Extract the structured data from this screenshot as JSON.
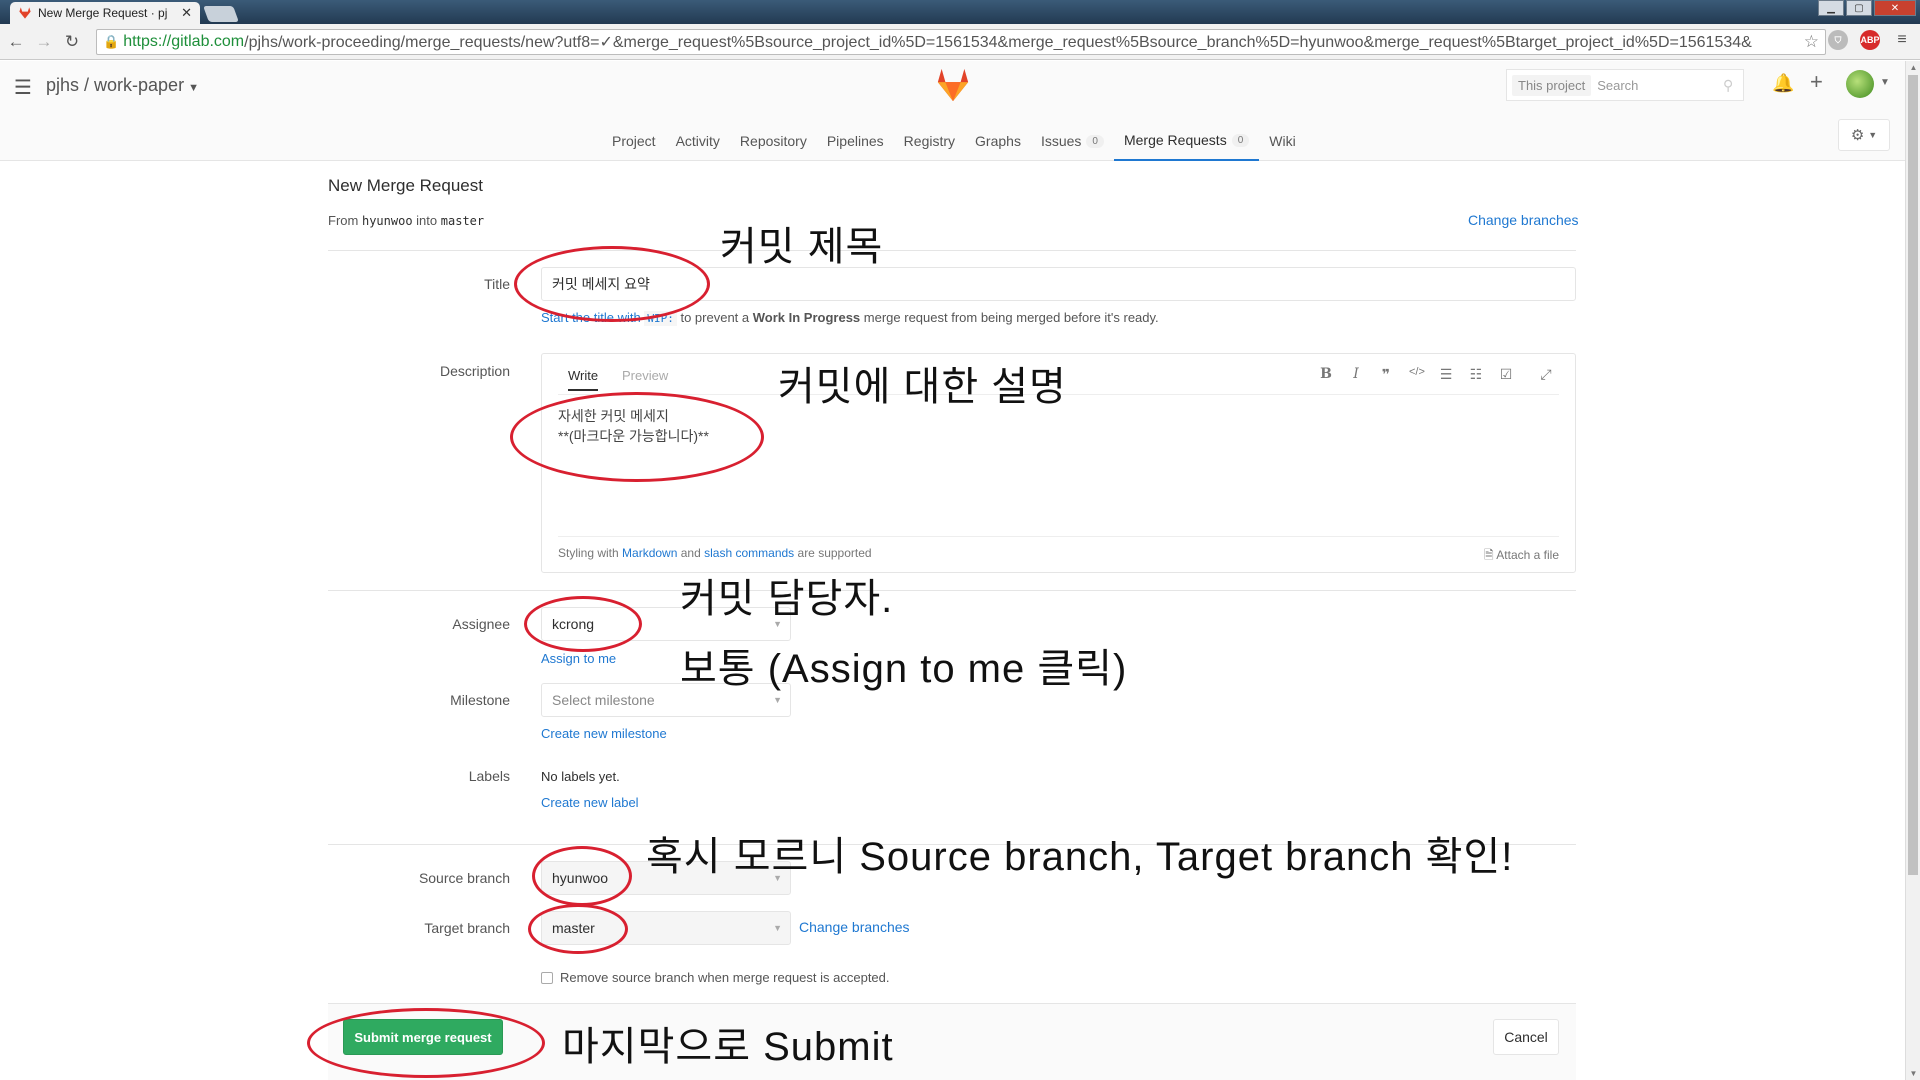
{
  "browser": {
    "tab_title": "New Merge Request · pj",
    "tab_close": "✕",
    "url_scheme_host": "https://gitlab.com",
    "url_rest": "/pjhs/work-proceeding/merge_requests/new?utf8=✓&merge_request%5Bsource_project_id%5D=1561534&merge_request%5Bsource_branch%5D=hyunwoo&merge_request%5Btarget_project_id%5D=1561534&",
    "ext_abp": "ABP"
  },
  "header": {
    "project_path": "pjhs / work-paper",
    "search_scope": "This project",
    "search_placeholder": "Search",
    "tabs": [
      {
        "label": "Project"
      },
      {
        "label": "Activity"
      },
      {
        "label": "Repository"
      },
      {
        "label": "Pipelines"
      },
      {
        "label": "Registry"
      },
      {
        "label": "Graphs"
      },
      {
        "label": "Issues",
        "badge": "0"
      },
      {
        "label": "Merge Requests",
        "badge": "0"
      },
      {
        "label": "Wiki"
      }
    ]
  },
  "page": {
    "title": "New Merge Request",
    "from_label": "From",
    "source": "hyunwoo",
    "into_label": "into",
    "target": "master",
    "change_branches": "Change branches"
  },
  "form": {
    "title_label": "Title",
    "title_value": "커밋 메세지 요약",
    "hint_link": "Start the title with",
    "hint_code": "WIP:",
    "hint_mid": "to prevent a",
    "hint_bold": "Work In Progress",
    "hint_end": "merge request from being merged before it's ready.",
    "description_label": "Description",
    "write_tab": "Write",
    "preview_tab": "Preview",
    "description_value": "자세한 커밋 메세지\n**(마크다운 가능합니다)**",
    "styling_with": "Styling with",
    "markdown_link": "Markdown",
    "and": "and",
    "slash_link": "slash commands",
    "supported": "are supported",
    "attach_file": "Attach a file",
    "assignee_label": "Assignee",
    "assignee_value": "kcrong",
    "assign_to_me": "Assign to me",
    "milestone_label": "Milestone",
    "milestone_placeholder": "Select milestone",
    "create_milestone": "Create new milestone",
    "labels_label": "Labels",
    "no_labels": "No labels yet.",
    "create_label": "Create new label",
    "source_branch_label": "Source branch",
    "source_branch_value": "hyunwoo",
    "target_branch_label": "Target branch",
    "target_branch_value": "master",
    "change_branches": "Change branches",
    "remove_source_branch": "Remove source branch when merge request is accepted.",
    "submit": "Submit merge request",
    "cancel": "Cancel"
  },
  "annotations": {
    "title_note": "커밋 제목",
    "description_note": "커밋에 대한 설명",
    "assignee_note": "커밋 담당자.",
    "assign_note": "보통 (Assign to me 클릭)",
    "branch_note": "혹시 모르니 Source branch, Target branch 확인!",
    "submit_note": "마지막으로 Submit"
  },
  "colors": {
    "link": "#1f78d1",
    "submit_green": "#2faa60",
    "annotation_red": "#d82030"
  }
}
